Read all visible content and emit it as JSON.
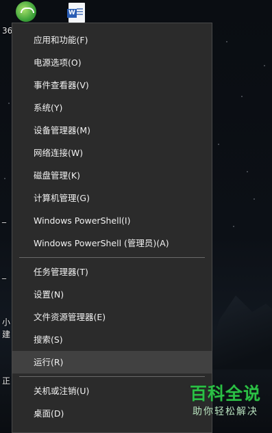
{
  "desktop": {
    "icons": [
      {
        "name": "360",
        "label": "36"
      },
      {
        "name": "word",
        "label": ""
      }
    ],
    "side_labels": [
      "_",
      "_",
      "小",
      "建",
      "正"
    ]
  },
  "menu": {
    "groups": [
      [
        "应用和功能(F)",
        "电源选项(O)",
        "事件查看器(V)",
        "系统(Y)",
        "设备管理器(M)",
        "网络连接(W)",
        "磁盘管理(K)",
        "计算机管理(G)",
        "Windows PowerShell(I)",
        "Windows PowerShell (管理员)(A)"
      ],
      [
        "任务管理器(T)",
        "设置(N)",
        "文件资源管理器(E)",
        "搜索(S)",
        "运行(R)"
      ],
      [
        "关机或注销(U)",
        "桌面(D)"
      ]
    ],
    "hovered_item": "运行(R)"
  },
  "watermark": {
    "title": "百科全说",
    "subtitle": "助你轻松解决"
  },
  "colors": {
    "menu_bg": "#2b2b2b",
    "hover_bg": "#414141",
    "watermark_green": "#2bbf45"
  }
}
